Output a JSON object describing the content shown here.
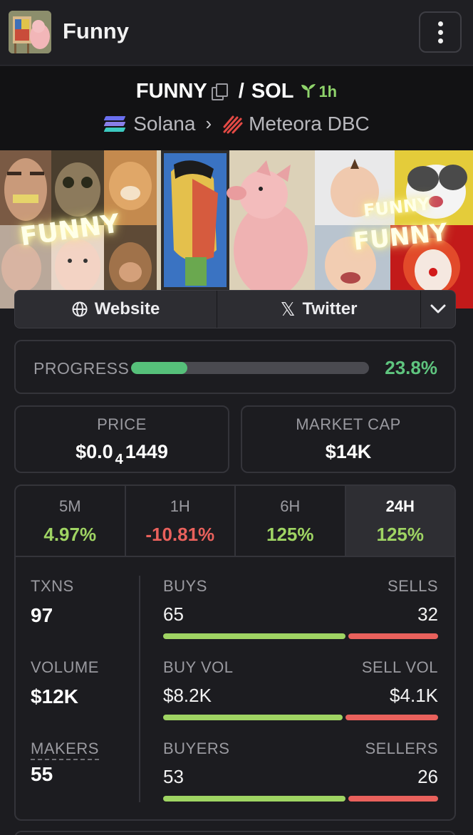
{
  "header": {
    "title": "Funny"
  },
  "pair": {
    "base": "FUNNY",
    "slash": "/",
    "quote": "SOL",
    "age": "1h",
    "chain": "Solana",
    "separator": "›",
    "dex": "Meteora DBC"
  },
  "banner": {
    "overlay_text_1": "FUNNY",
    "overlay_text_2": "FUNNY",
    "overlay_text_3": "FUNNY"
  },
  "links": {
    "website": "Website",
    "twitter": "Twitter"
  },
  "progress": {
    "label": "PROGRESS",
    "value": "23.8%",
    "fraction": 0.238
  },
  "price": {
    "label": "PRICE",
    "prefix": "$0.0",
    "zeros": "4",
    "digits": "1449"
  },
  "market_cap": {
    "label": "MARKET CAP",
    "value": "$14K"
  },
  "timeframes": [
    {
      "label": "5M",
      "value": "4.97%",
      "trend": "up"
    },
    {
      "label": "1H",
      "value": "-10.81%",
      "trend": "down"
    },
    {
      "label": "6H",
      "value": "125%",
      "trend": "up"
    },
    {
      "label": "24H",
      "value": "125%",
      "trend": "up",
      "selected": true
    }
  ],
  "stats": {
    "txns": {
      "label": "TXNS",
      "value": "97"
    },
    "volume": {
      "label": "VOLUME",
      "value": "$12K"
    },
    "makers": {
      "label": "MAKERS",
      "value": "55"
    },
    "buys": {
      "label_left": "BUYS",
      "label_right": "SELLS",
      "left": "65",
      "right": "32",
      "buy_share": 0.67
    },
    "vol": {
      "label_left": "BUY VOL",
      "label_right": "SELL VOL",
      "left": "$8.2K",
      "right": "$4.1K",
      "buy_share": 0.66
    },
    "buyers": {
      "label_left": "BUYERS",
      "label_right": "SELLERS",
      "left": "53",
      "right": "26",
      "buy_share": 0.67
    }
  },
  "colors": {
    "positive": "#9fd463",
    "negative": "#e9615c",
    "progress": "#56c07a"
  }
}
